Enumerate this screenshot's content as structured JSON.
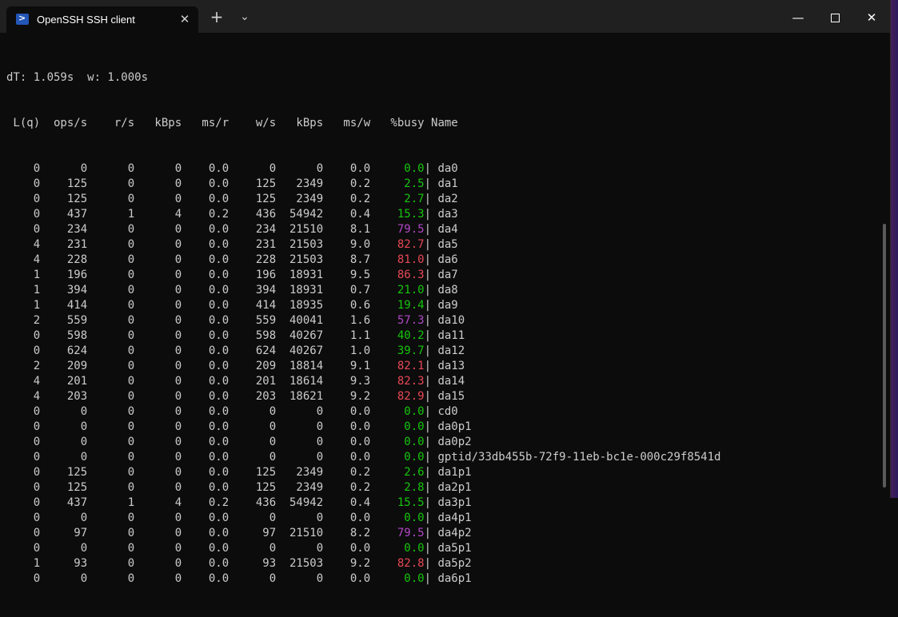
{
  "window": {
    "tab_title": "OpenSSH SSH client",
    "tab_icon": "powershell-icon",
    "close_tab_glyph": "✕",
    "new_tab_glyph": "+",
    "dropdown_glyph": "⌄",
    "minimize_glyph": "—",
    "close_glyph": "✕"
  },
  "terminal": {
    "header_line": "dT: 1.059s  w: 1.000s",
    "column_header": " L(q)  ops/s    r/s   kBps   ms/r    w/s   kBps   ms/w   %busy Name",
    "rows": [
      {
        "prefix": "    0      0      0      0    0.0      0      0    0.0    ",
        "busy": " 0.0",
        "level": "green",
        "name": "| da0"
      },
      {
        "prefix": "    0    125      0      0    0.0    125   2349    0.2    ",
        "busy": " 2.5",
        "level": "green",
        "name": "| da1"
      },
      {
        "prefix": "    0    125      0      0    0.0    125   2349    0.2    ",
        "busy": " 2.7",
        "level": "green",
        "name": "| da2"
      },
      {
        "prefix": "    0    437      1      4    0.2    436  54942    0.4   ",
        "busy": " 15.3",
        "level": "green",
        "name": "| da3"
      },
      {
        "prefix": "    0    234      0      0    0.0    234  21510    8.1   ",
        "busy": " 79.5",
        "level": "magenta",
        "name": "| da4"
      },
      {
        "prefix": "    4    231      0      0    0.0    231  21503    9.0   ",
        "busy": " 82.7",
        "level": "red",
        "name": "| da5"
      },
      {
        "prefix": "    4    228      0      0    0.0    228  21503    8.7   ",
        "busy": " 81.0",
        "level": "red",
        "name": "| da6"
      },
      {
        "prefix": "    1    196      0      0    0.0    196  18931    9.5   ",
        "busy": " 86.3",
        "level": "red",
        "name": "| da7"
      },
      {
        "prefix": "    1    394      0      0    0.0    394  18931    0.7   ",
        "busy": " 21.0",
        "level": "green",
        "name": "| da8"
      },
      {
        "prefix": "    1    414      0      0    0.0    414  18935    0.6   ",
        "busy": " 19.4",
        "level": "green",
        "name": "| da9"
      },
      {
        "prefix": "    2    559      0      0    0.0    559  40041    1.6   ",
        "busy": " 57.3",
        "level": "magenta",
        "name": "| da10"
      },
      {
        "prefix": "    0    598      0      0    0.0    598  40267    1.1   ",
        "busy": " 40.2",
        "level": "green",
        "name": "| da11"
      },
      {
        "prefix": "    0    624      0      0    0.0    624  40267    1.0   ",
        "busy": " 39.7",
        "level": "green",
        "name": "| da12"
      },
      {
        "prefix": "    2    209      0      0    0.0    209  18814    9.1   ",
        "busy": " 82.1",
        "level": "red",
        "name": "| da13"
      },
      {
        "prefix": "    4    201      0      0    0.0    201  18614    9.3   ",
        "busy": " 82.3",
        "level": "red",
        "name": "| da14"
      },
      {
        "prefix": "    4    203      0      0    0.0    203  18621    9.2   ",
        "busy": " 82.9",
        "level": "red",
        "name": "| da15"
      },
      {
        "prefix": "    0      0      0      0    0.0      0      0    0.0    ",
        "busy": " 0.0",
        "level": "green",
        "name": "| cd0"
      },
      {
        "prefix": "    0      0      0      0    0.0      0      0    0.0    ",
        "busy": " 0.0",
        "level": "green",
        "name": "| da0p1"
      },
      {
        "prefix": "    0      0      0      0    0.0      0      0    0.0    ",
        "busy": " 0.0",
        "level": "green",
        "name": "| da0p2"
      },
      {
        "prefix": "    0      0      0      0    0.0      0      0    0.0    ",
        "busy": " 0.0",
        "level": "green",
        "name": "| gptid/33db455b-72f9-11eb-bc1e-000c29f8541d"
      },
      {
        "prefix": "    0    125      0      0    0.0    125   2349    0.2    ",
        "busy": " 2.6",
        "level": "green",
        "name": "| da1p1"
      },
      {
        "prefix": "    0    125      0      0    0.0    125   2349    0.2    ",
        "busy": " 2.8",
        "level": "green",
        "name": "| da2p1"
      },
      {
        "prefix": "    0    437      1      4    0.2    436  54942    0.4   ",
        "busy": " 15.5",
        "level": "green",
        "name": "| da3p1"
      },
      {
        "prefix": "    0      0      0      0    0.0      0      0    0.0    ",
        "busy": " 0.0",
        "level": "green",
        "name": "| da4p1"
      },
      {
        "prefix": "    0     97      0      0    0.0     97  21510    8.2   ",
        "busy": " 79.5",
        "level": "magenta",
        "name": "| da4p2"
      },
      {
        "prefix": "    0      0      0      0    0.0      0      0    0.0    ",
        "busy": " 0.0",
        "level": "green",
        "name": "| da5p1"
      },
      {
        "prefix": "    1     93      0      0    0.0     93  21503    9.2   ",
        "busy": " 82.8",
        "level": "red",
        "name": "| da5p2"
      },
      {
        "prefix": "    0      0      0      0    0.0      0      0    0.0    ",
        "busy": " 0.0",
        "level": "green",
        "name": "| da6p1"
      }
    ]
  },
  "colors": {
    "background": "#0c0c0c",
    "text": "#cccccc",
    "busy_low": "#16c60c",
    "busy_mid": "#b148c6",
    "busy_high": "#e74856"
  }
}
